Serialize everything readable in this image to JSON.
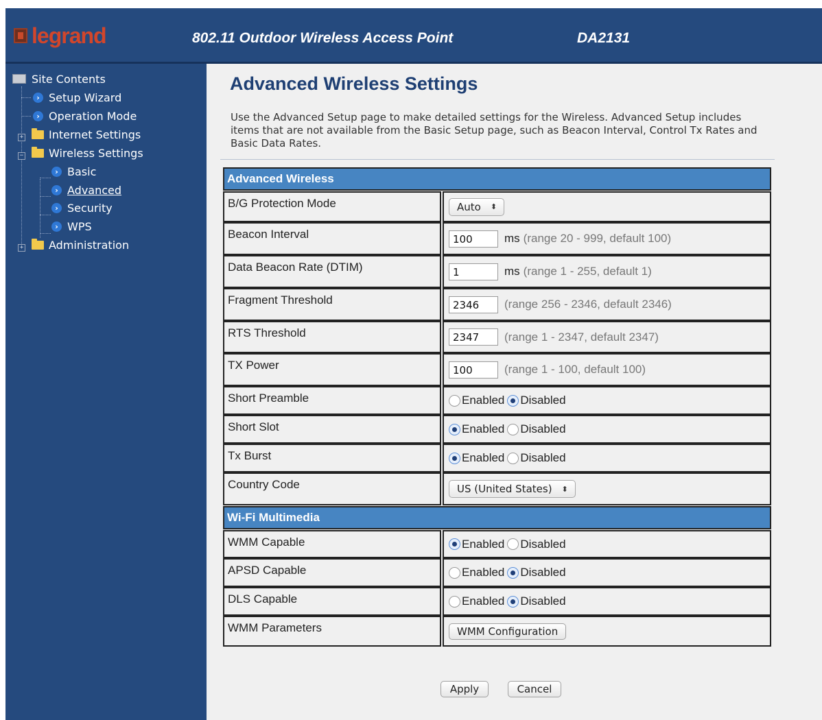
{
  "header": {
    "logo_text": "legrand",
    "product": "802.11 Outdoor Wireless Access Point",
    "model": "DA2131"
  },
  "sidebar": {
    "root": "Site Contents",
    "items": [
      {
        "label": "Setup Wizard",
        "icon": "arrow-icon"
      },
      {
        "label": "Operation Mode",
        "icon": "arrow-icon"
      },
      {
        "label": "Internet Settings",
        "icon": "folder-icon"
      },
      {
        "label": "Wireless Settings",
        "icon": "folder-icon"
      },
      {
        "label": "Basic",
        "icon": "arrow-icon"
      },
      {
        "label": "Advanced",
        "icon": "arrow-icon"
      },
      {
        "label": "Security",
        "icon": "arrow-icon"
      },
      {
        "label": "WPS",
        "icon": "arrow-icon"
      },
      {
        "label": "Administration",
        "icon": "folder-icon"
      }
    ]
  },
  "page": {
    "title": "Advanced Wireless Settings",
    "intro": "Use the Advanced Setup page to make detailed settings for the Wireless. Advanced Setup includes items that are not available from the Basic Setup page, such as Beacon Interval, Control Tx Rates and Basic Data Rates."
  },
  "sections": {
    "advanced": "Advanced Wireless",
    "wmm": "Wi-Fi Multimedia"
  },
  "fields": {
    "bg_protection": {
      "label": "B/G Protection Mode",
      "value": "Auto"
    },
    "beacon_interval": {
      "label": "Beacon Interval",
      "value": "100",
      "unit": "ms",
      "hint": "(range 20 - 999, default 100)"
    },
    "dtim": {
      "label": "Data Beacon Rate (DTIM)",
      "value": "1",
      "unit": "ms",
      "hint": "(range 1 - 255, default 1)"
    },
    "fragment": {
      "label": "Fragment Threshold",
      "value": "2346",
      "hint": "(range 256 - 2346, default 2346)"
    },
    "rts": {
      "label": "RTS Threshold",
      "value": "2347",
      "hint": "(range 1 - 2347, default 2347)"
    },
    "tx_power": {
      "label": "TX Power",
      "value": "100",
      "hint": "(range 1 - 100, default 100)"
    },
    "short_preamble": {
      "label": "Short Preamble",
      "selected": "Disabled"
    },
    "short_slot": {
      "label": "Short Slot",
      "selected": "Enabled"
    },
    "tx_burst": {
      "label": "Tx Burst",
      "selected": "Enabled"
    },
    "country_code": {
      "label": "Country Code",
      "value": "US (United States)"
    },
    "wmm_capable": {
      "label": "WMM Capable",
      "selected": "Enabled"
    },
    "apsd_capable": {
      "label": "APSD Capable",
      "selected": "Disabled"
    },
    "dls_capable": {
      "label": "DLS Capable",
      "selected": "Disabled"
    },
    "wmm_parameters": {
      "label": "WMM Parameters",
      "button": "WMM Configuration"
    }
  },
  "radio_labels": {
    "enabled": "Enabled",
    "disabled": "Disabled"
  },
  "buttons": {
    "apply": "Apply",
    "cancel": "Cancel"
  }
}
